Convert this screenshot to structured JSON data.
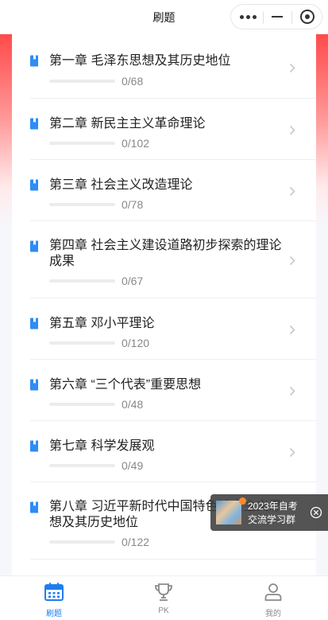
{
  "nav": {
    "title": "刷题"
  },
  "chapters": [
    {
      "title": "第一章 毛泽东思想及其历史地位",
      "progress": "0/68",
      "done": 0,
      "total": 68
    },
    {
      "title": "第二章 新民主主义革命理论",
      "progress": "0/102",
      "done": 0,
      "total": 102
    },
    {
      "title": "第三章 社会主义改造理论",
      "progress": "0/78",
      "done": 0,
      "total": 78
    },
    {
      "title": "第四章 社会主义建设道路初步探索的理论成果",
      "progress": "0/67",
      "done": 0,
      "total": 67
    },
    {
      "title": "第五章 邓小平理论",
      "progress": "0/120",
      "done": 0,
      "total": 120
    },
    {
      "title": "第六章 “三个代表”重要思想",
      "progress": "0/48",
      "done": 0,
      "total": 48
    },
    {
      "title": "第七章 科学发展观",
      "progress": "0/49",
      "done": 0,
      "total": 49
    },
    {
      "title": "第八章 习近平新时代中国特色社会主义思想及其历史地位",
      "progress": "0/122",
      "done": 0,
      "total": 122
    }
  ],
  "promo": {
    "line1": "2023年自考",
    "line2": "交流学习群"
  },
  "tabbar": {
    "items": [
      {
        "label": "刷题",
        "icon": "calendar-icon",
        "active": true
      },
      {
        "label": "PK",
        "icon": "trophy-icon",
        "active": false
      },
      {
        "label": "我的",
        "icon": "user-icon",
        "active": false
      }
    ]
  },
  "colors": {
    "accent": "#1e7ef0",
    "icon_blue": "#2e8cf3",
    "header_gradient_top": "#ff4a4a",
    "tab_inactive": "#8a8a8a"
  }
}
